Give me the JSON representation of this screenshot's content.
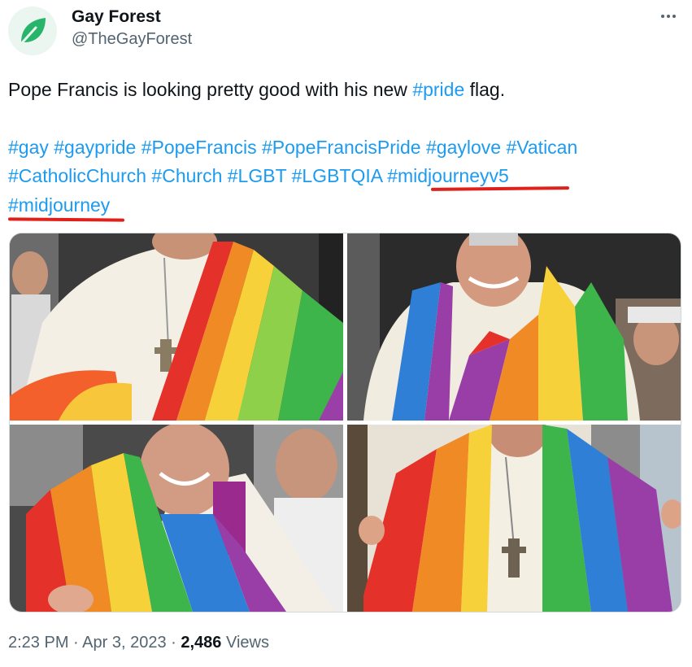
{
  "author": {
    "name": "Gay Forest",
    "handle": "@TheGayForest",
    "avatar_icon": "leaf-icon",
    "avatar_color": "#28b46b"
  },
  "more_icon": "ellipsis-icon",
  "tweet": {
    "text_before": "Pope Francis is looking pretty good with his new ",
    "pride_tag": "#pride",
    "text_after": " flag.",
    "hashtags": [
      "#gay",
      "#gaypride",
      "#PopeFrancis",
      "#PopeFrancisPride",
      "#gaylove",
      "#Vatican",
      "#CatholicChurch",
      "#Church",
      "#LGBT",
      "#LGBTQIA",
      "#midjourneyv5",
      "#midjourney"
    ],
    "underlined_tags": [
      "#midjourneyv5",
      "#midjourney"
    ],
    "underline_color": "#e0201a",
    "link_color": "#1d9bf0"
  },
  "media": {
    "count": 4,
    "description_icons": [
      "photo-pope-1",
      "photo-pope-2",
      "photo-pope-3",
      "photo-pope-4"
    ]
  },
  "meta": {
    "time": "2:23 PM",
    "sep1": " · ",
    "date": "Apr 3, 2023",
    "sep2": " · ",
    "views_count": "2,486",
    "views_label": " Views"
  }
}
